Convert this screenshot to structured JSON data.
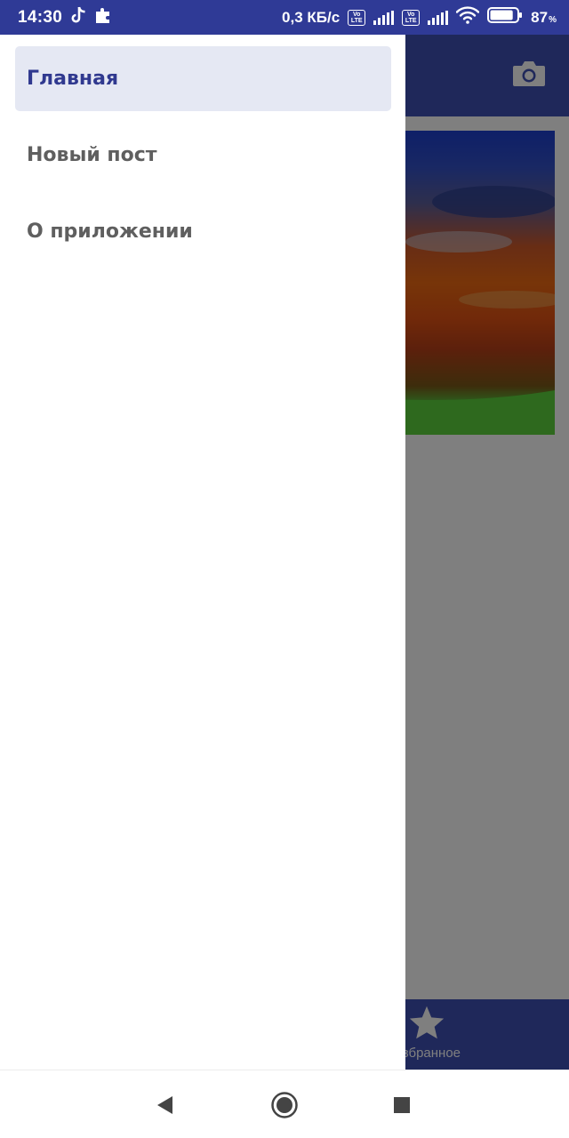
{
  "status_bar": {
    "time": "14:30",
    "net_speed": "0,3 КБ/с",
    "volte_label_top": "Vo",
    "volte_label_bottom": "LTE",
    "battery_percent": "87",
    "battery_percent_sign": "%",
    "battery_level": 0.87,
    "icons": [
      "tiktok-icon",
      "puzzle-icon",
      "volte-icon",
      "signal-icon",
      "wifi-icon",
      "battery-icon"
    ]
  },
  "app": {
    "toolbar_action_icon": "camera-icon",
    "bottom_nav": {
      "favorites_label": "Избранное",
      "favorites_icon": "star-icon"
    }
  },
  "drawer": {
    "items": [
      {
        "label": "Главная",
        "active": true
      },
      {
        "label": "Новый пост",
        "active": false
      },
      {
        "label": "О приложении",
        "active": false
      }
    ]
  },
  "system_nav": {
    "buttons": [
      "back-icon",
      "home-icon",
      "recents-icon"
    ]
  },
  "colors": {
    "status_bar": "#2f3a96",
    "primary": "#3f51b5",
    "drawer_active_bg": "#e5e8f3",
    "drawer_active_text": "#30398f",
    "drawer_text": "#5f5f5f"
  }
}
